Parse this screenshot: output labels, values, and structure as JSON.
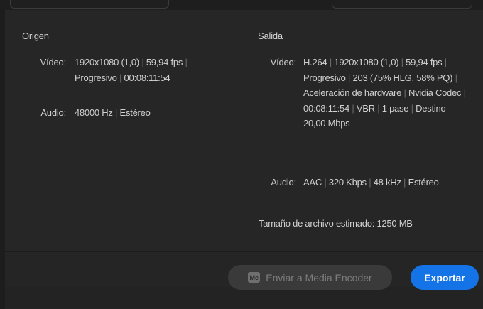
{
  "origin": {
    "title": "Origen",
    "video_label": "Vídeo:",
    "video_parts": [
      "1920x1080 (1,0)",
      "59,94 fps",
      "Progresivo",
      "00:08:11:54"
    ],
    "audio_label": "Audio:",
    "audio_parts": [
      "48000 Hz",
      "Estéreo"
    ]
  },
  "output": {
    "title": "Salida",
    "video_label": "Vídeo:",
    "video_parts": [
      "H.264",
      "1920x1080 (1,0)",
      "59,94 fps",
      "Progresivo",
      "203 (75% HLG, 58% PQ)",
      "Aceleración de hardware",
      "Nvidia Codec",
      "00:08:11:54",
      "VBR",
      "1 pase",
      "Destino 20,00 Mbps"
    ],
    "audio_label": "Audio:",
    "audio_parts": [
      "AAC",
      "320 Kbps",
      "48 kHz",
      "Estéreo"
    ],
    "filesize_label": "Tamaño de archivo estimado:",
    "filesize_value": "1250 MB"
  },
  "footer": {
    "ame_icon_text": "Me",
    "ame_label": "Enviar a Media Encoder",
    "export_label": "Exportar"
  },
  "icons": {
    "ame": "media-encoder-icon"
  },
  "colors": {
    "accent": "#1473e6",
    "panel": "#262626",
    "separator": "#6a6a6a"
  }
}
